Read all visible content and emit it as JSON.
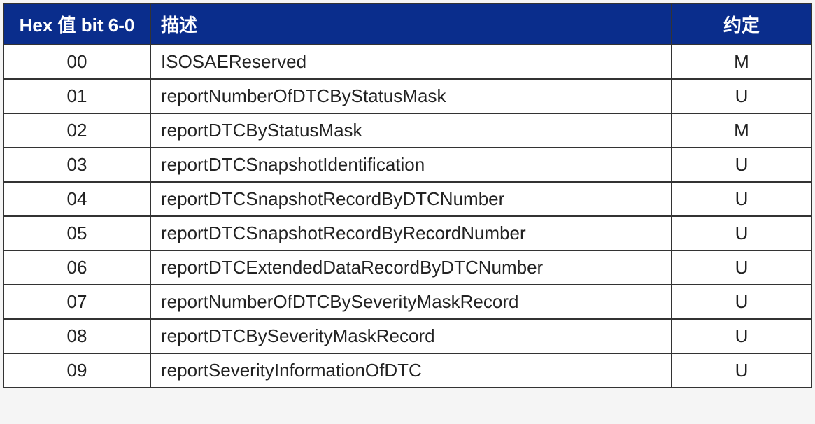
{
  "headers": {
    "hex": "Hex 值 bit 6-0",
    "desc": "描述",
    "conv": "约定"
  },
  "rows": [
    {
      "hex": "00",
      "desc": "ISOSAEReserved",
      "conv": "M"
    },
    {
      "hex": "01",
      "desc": "reportNumberOfDTCByStatusMask",
      "conv": "U"
    },
    {
      "hex": "02",
      "desc": "reportDTCByStatusMask",
      "conv": "M"
    },
    {
      "hex": "03",
      "desc": "reportDTCSnapshotIdentification",
      "conv": "U"
    },
    {
      "hex": "04",
      "desc": "reportDTCSnapshotRecordByDTCNumber",
      "conv": "U"
    },
    {
      "hex": "05",
      "desc": "reportDTCSnapshotRecordByRecordNumber",
      "conv": "U"
    },
    {
      "hex": "06",
      "desc": "reportDTCExtendedDataRecordByDTCNumber",
      "conv": "U"
    },
    {
      "hex": "07",
      "desc": "reportNumberOfDTCBySeverityMaskRecord",
      "conv": "U"
    },
    {
      "hex": "08",
      "desc": "reportDTCBySeverityMaskRecord",
      "conv": "U"
    },
    {
      "hex": "09",
      "desc": "reportSeverityInformationOfDTC",
      "conv": "U"
    }
  ]
}
